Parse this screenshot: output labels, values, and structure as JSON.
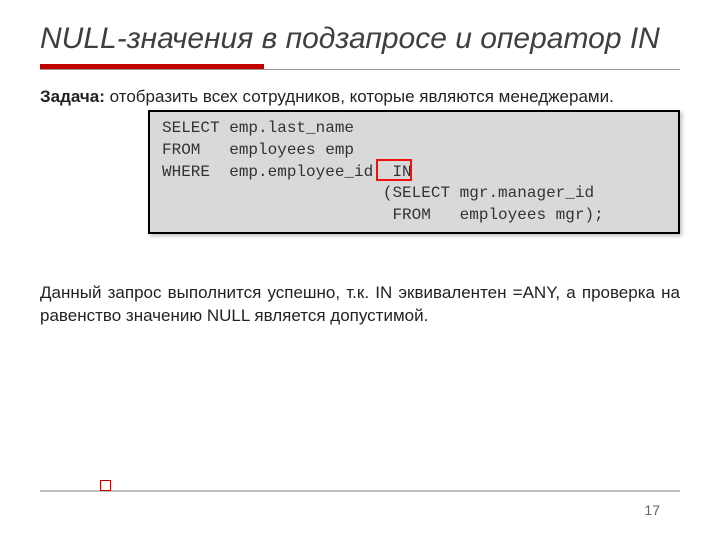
{
  "title": "NULL-значения в подзапросе и оператор IN",
  "task_label": "Задача:",
  "task_text": " отобразить всех сотрудников, которые являются менеджерами.",
  "code": "SELECT emp.last_name\nFROM   employees emp\nWHERE  emp.employee_id  IN\n                       (SELECT mgr.manager_id\n                        FROM   employees mgr);",
  "explain": "Данный запрос выполнится успешно, т.к. IN эквивалентен =ANY, а проверка на равенство значению NULL  является допустимой.",
  "page_number": "17"
}
